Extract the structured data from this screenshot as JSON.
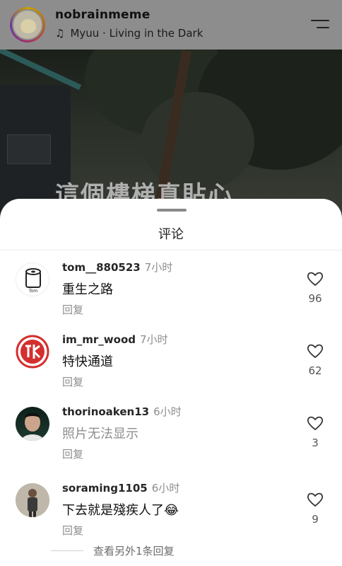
{
  "header": {
    "username": "nobrainmeme",
    "music_text": "Myuu · Living in the Dark"
  },
  "photo": {
    "overlay_text": "這個樓梯真貼心"
  },
  "comments_sheet": {
    "title": "评论",
    "comments": [
      {
        "username": "tom__880523",
        "time": "7小时",
        "text": "重生之路",
        "reply": "回复",
        "likes": "96"
      },
      {
        "username": "im_mr_wood",
        "time": "7小时",
        "text": "特快通道",
        "reply": "回复",
        "likes": "62"
      },
      {
        "username": "thorinoaken13",
        "time": "6小时",
        "text": "照片无法显示",
        "reply": "回复",
        "likes": "3"
      },
      {
        "username": "soraming1105",
        "time": "6小时",
        "text": "下去就是殘疾人了😂",
        "reply": "回复",
        "likes": "9"
      }
    ],
    "more_replies": "查看另外1条回复"
  },
  "colors": {
    "accent": "#ed4956",
    "text_gray": "#8e8e8e"
  }
}
